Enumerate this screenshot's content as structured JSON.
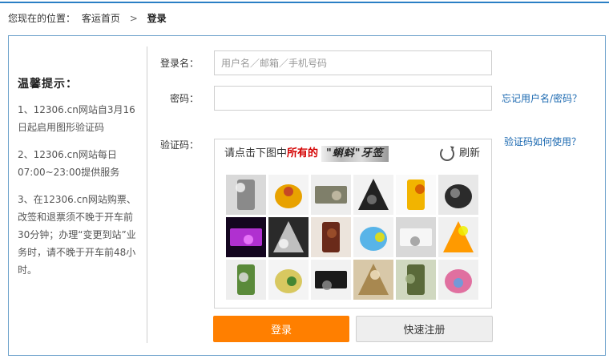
{
  "breadcrumb": {
    "prefix": "您现在的位置：",
    "home": "客运首页",
    "separator": ">",
    "current": "登录"
  },
  "tips": {
    "title": "温馨提示：",
    "items": [
      "1、12306.cn网站自3月16日起启用图形验证码",
      "2、12306.cn网站每日07:00~23:00提供服务",
      "3、在12306.cn网站购票、改签和退票须不晚于开车前30分钟；办理“变更到站”业务时，请不晚于开车前48小时。"
    ]
  },
  "form": {
    "username_label": "登录名：",
    "username_placeholder": "用户名／邮箱／手机号码",
    "username_value": "",
    "password_label": "密码：",
    "password_value": "",
    "forgot_link": "忘记用户名/密码？",
    "captcha_label": "验证码：",
    "captcha_help_link": "验证码如何使用？"
  },
  "captcha": {
    "prompt_before": "请点击下图中",
    "prompt_emphasis": "所有的",
    "target_word": "\"蝌蚪\"牙签",
    "refresh_label": "刷新",
    "images": [
      {
        "name": "thermos-cups",
        "colors": [
          "#d9d9d9",
          "#8a8a8a",
          "#f2f2f2"
        ]
      },
      {
        "name": "cooking-oil-bottle",
        "colors": [
          "#f4f4f4",
          "#e8a200",
          "#c0392b"
        ]
      },
      {
        "name": "usb-drive",
        "colors": [
          "#ededed",
          "#7f7f6a",
          "#c8c0a8"
        ]
      },
      {
        "name": "keyboard",
        "colors": [
          "#f2f2f2",
          "#222222",
          "#777777"
        ]
      },
      {
        "name": "oil-bottle-yellow",
        "colors": [
          "#fafafa",
          "#f2b400",
          "#d35400"
        ]
      },
      {
        "name": "zipper",
        "colors": [
          "#e8e8e8",
          "#2b2b2b",
          "#8c8c8c"
        ]
      },
      {
        "name": "music-fountain-purple",
        "colors": [
          "#14061f",
          "#b030d0",
          "#f080ff"
        ]
      },
      {
        "name": "fountain-white",
        "colors": [
          "#2a2a2a",
          "#bfbfbf",
          "#f4f4f4"
        ]
      },
      {
        "name": "dried-dates-plate",
        "colors": [
          "#ece4dc",
          "#6a2a1a",
          "#a0522d"
        ]
      },
      {
        "name": "lighters",
        "colors": [
          "#f2f2f2",
          "#58b4e8",
          "#f0e000"
        ]
      },
      {
        "name": "handwritten-paper",
        "colors": [
          "#d8d8d8",
          "#f6f6f6",
          "#9a9a9a"
        ]
      },
      {
        "name": "colored-sticky-notes",
        "colors": [
          "#f0f0f0",
          "#ff9a00",
          "#f0f000"
        ]
      },
      {
        "name": "seed-packet",
        "colors": [
          "#eeeeee",
          "#5a8a3a",
          "#dcdcdc"
        ]
      },
      {
        "name": "oil-bottle-green-label",
        "colors": [
          "#f4f4f4",
          "#d8c860",
          "#2a7a2a"
        ]
      },
      {
        "name": "earphones",
        "colors": [
          "#f2f2f2",
          "#1a1a1a",
          "#8a8a8a"
        ]
      },
      {
        "name": "peanuts",
        "colors": [
          "#d8c8a8",
          "#a88850",
          "#f0e0c0"
        ]
      },
      {
        "name": "tadpole-toothpick",
        "colors": [
          "#d0d8c0",
          "#5a6a3a",
          "#9aaa7a"
        ]
      },
      {
        "name": "confetti-pieces",
        "colors": [
          "#f0f0f0",
          "#e070a0",
          "#60a0e0"
        ]
      }
    ]
  },
  "buttons": {
    "login": "登录",
    "register": "快速注册"
  },
  "colors": {
    "accent_blue": "#2a7fc5",
    "link_blue": "#1a68b0",
    "login_orange": "#ff7f00",
    "captcha_emphasis_red": "#d40000"
  }
}
